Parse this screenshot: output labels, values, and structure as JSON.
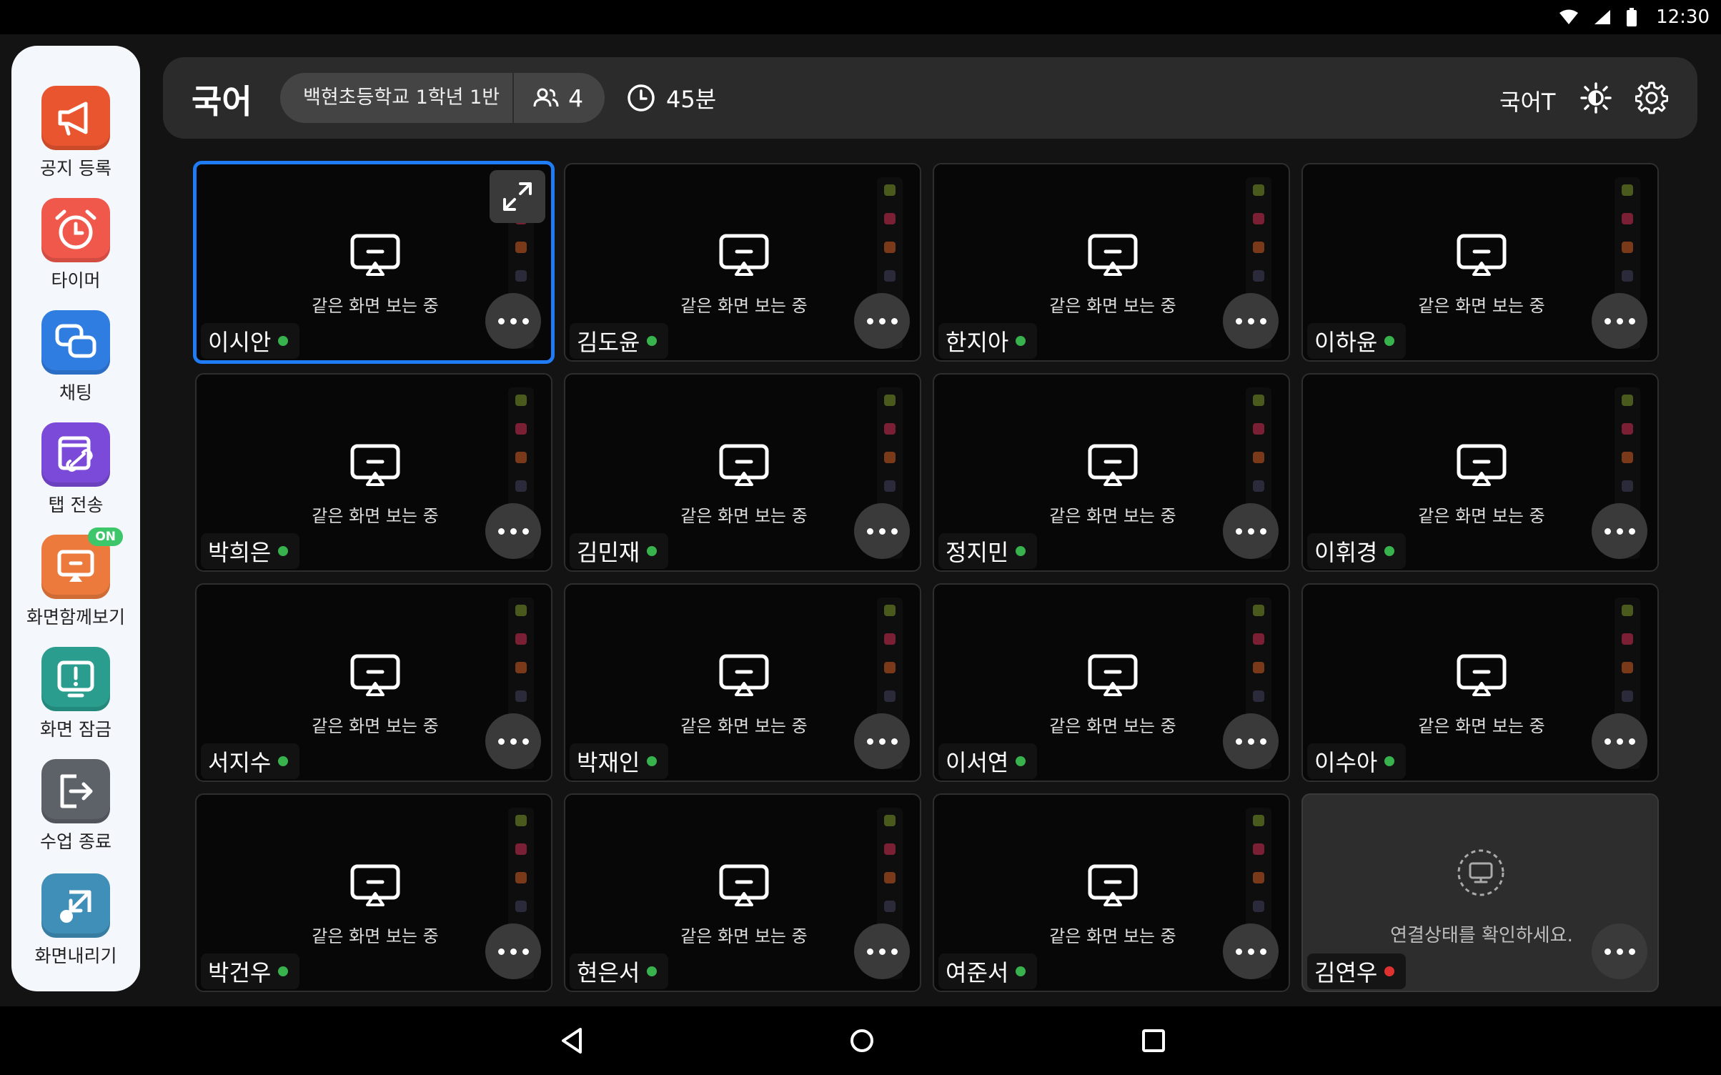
{
  "status_bar": {
    "time": "12:30"
  },
  "sidebar": {
    "items": [
      {
        "label": "공지 등록",
        "icon": "megaphone-icon",
        "color": "#e8552f",
        "badge": ""
      },
      {
        "label": "타이머",
        "icon": "alarm-clock-icon",
        "color": "#f0584b",
        "badge": ""
      },
      {
        "label": "채팅",
        "icon": "chat-bubbles-icon",
        "color": "#2f7de1",
        "badge": ""
      },
      {
        "label": "탭 전송",
        "icon": "tab-link-icon",
        "color": "#7c4ad9",
        "badge": ""
      },
      {
        "label": "화면함께보기",
        "icon": "screen-share-icon",
        "color": "#ec7a3c",
        "badge": "ON"
      },
      {
        "label": "화면 잠금",
        "icon": "screen-lock-icon",
        "color": "#2a9d8f",
        "badge": ""
      },
      {
        "label": "수업 종료",
        "icon": "exit-icon",
        "color": "#5d6168",
        "badge": ""
      },
      {
        "label": "화면내리기",
        "icon": "screen-down-icon",
        "color": "#3f8fb8",
        "badge": ""
      }
    ]
  },
  "header": {
    "subject": "국어",
    "school": "백현초등학교 1학년 1반",
    "student_count": "4",
    "duration": "45분",
    "teacher": "국어T"
  },
  "tiles": {
    "status_text": "같은 화면 보는 중",
    "offline_text": "연결상태를 확인하세요.",
    "students": [
      {
        "name": "이시안",
        "online": true,
        "selected": true
      },
      {
        "name": "김도윤",
        "online": true
      },
      {
        "name": "한지아",
        "online": true
      },
      {
        "name": "이하윤",
        "online": true
      },
      {
        "name": "박희은",
        "online": true
      },
      {
        "name": "김민재",
        "online": true
      },
      {
        "name": "정지민",
        "online": true
      },
      {
        "name": "이휘경",
        "online": true
      },
      {
        "name": "서지수",
        "online": true
      },
      {
        "name": "박재인",
        "online": true
      },
      {
        "name": "이서연",
        "online": true
      },
      {
        "name": "이수아",
        "online": true
      },
      {
        "name": "박건우",
        "online": true
      },
      {
        "name": "현은서",
        "online": true
      },
      {
        "name": "여준서",
        "online": true
      },
      {
        "name": "김연우",
        "online": false
      }
    ]
  },
  "colors": {
    "accent": "#1f7cf5",
    "online": "#37b24d",
    "offline": "#e03131",
    "background": "#131313"
  }
}
